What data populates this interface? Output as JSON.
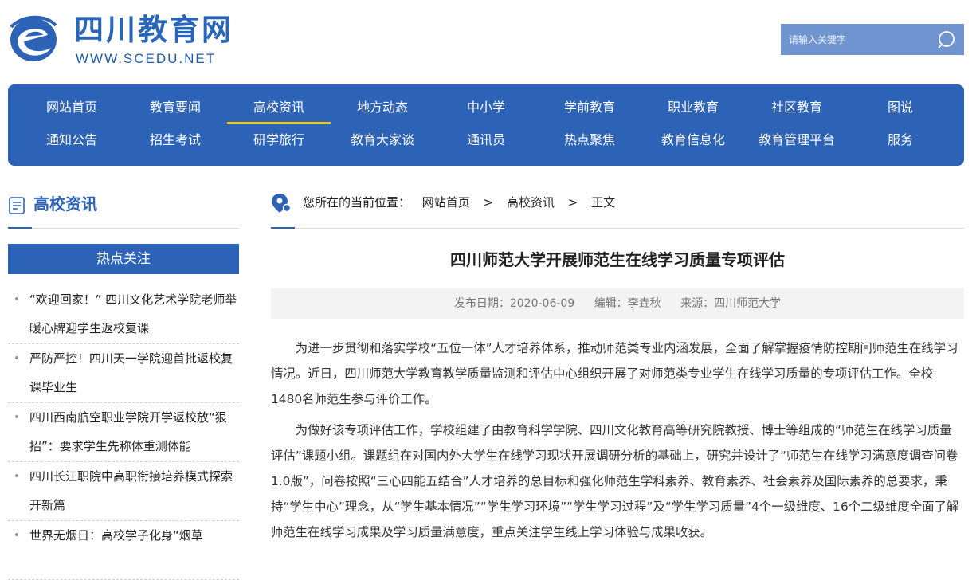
{
  "site": {
    "title": "四川教育网",
    "url_text": "WWW.SCEDU.NET"
  },
  "search": {
    "placeholder": "请输入关键字"
  },
  "colors": {
    "brand": "#2d63b6",
    "active_underline": "#f5d11d",
    "search_bg": "#6f94cf"
  },
  "nav": {
    "row1": [
      "网站首页",
      "教育要闻",
      "高校资讯",
      "地方动态",
      "中小学",
      "学前教育",
      "职业教育",
      "社区教育",
      "图说"
    ],
    "row2": [
      "通知公告",
      "招生考试",
      "研学旅行",
      "教育大家谈",
      "通讯员",
      "热点聚焦",
      "教育信息化",
      "教育管理平台",
      "服务"
    ],
    "active": "高校资讯"
  },
  "sidebar": {
    "section_title": "高校资讯",
    "hot_title": "热点关注",
    "hot_items": [
      "“欢迎回家！” 四川文化艺术学院老师举暖心牌迎学生返校复课",
      "严防严控！四川天一学院迎首批返校复课毕业生",
      "四川西南航空职业学院开学返校放“狠招”：要求学生先称体重测体能",
      "四川长江职院中高职衔接培养模式探索开新篇",
      "世界无烟日：高校学子化身“烟草"
    ]
  },
  "breadcrumb": {
    "prefix": "您所在的当前位置：",
    "items": [
      "网站首页",
      "高校资讯",
      "正文"
    ],
    "separator": ">"
  },
  "article": {
    "title": "四川师范大学开展师范生在线学习质量专项评估",
    "date": "发布日期：2020-06-09",
    "editor": "编辑：李垚秋",
    "source": "来源：四川师范大学",
    "paragraphs": [
      "为进一步贯彻和落实学校“五位一体”人才培养体系，推动师范类专业内涵发展，全面了解掌握疫情防控期间师范生在线学习情况。近日，四川师范大学教育教学质量监测和评估中心组织开展了对师范类专业学生在线学习质量的专项评估工作。全校1480名师范生参与评价工作。",
      "为做好该专项评估工作，学校组建了由教育科学学院、四川文化教育高等研究院教授、博士等组成的“师范生在线学习质量评估”课题小组。课题组在对国内外大学生在线学习现状开展调研分析的基础上，研究并设计了“师范生在线学习满意度调查问卷1.0版”，问卷按照“三心四能五结合”人才培养的总目标和强化师范生学科素养、教育素养、社会素养及国际素养的总要求，秉持“学生中心”理念，从“学生基本情况”“学生学习环境”“学生学习过程”及“学生学习质量”4个一级维度、16个二级维度全面了解师范生在线学习成果及学习质量满意度，重点关注学生线上学习体验与成果收获。"
    ]
  }
}
